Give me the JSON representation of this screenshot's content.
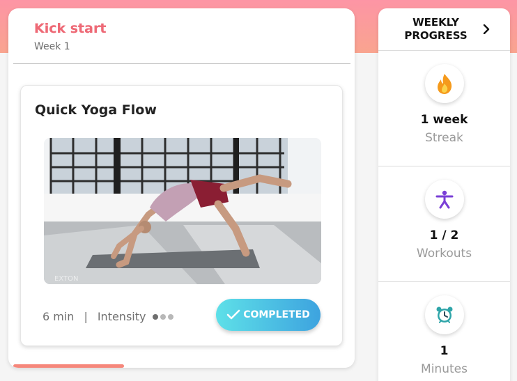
{
  "program": {
    "title": "Kick start",
    "week": "Week 1"
  },
  "workout": {
    "title": "Quick Yoga Flow",
    "duration": "6 min",
    "separator": "|",
    "intensity_label": "Intensity",
    "intensity_level": 1,
    "intensity_max": 3,
    "status_label": "COMPLETED"
  },
  "program_progress": 0.32,
  "weekly_progress": {
    "header": "WEEKLY\nPROGRESS",
    "stats": [
      {
        "value": "1 week",
        "label": "Streak",
        "icon": "flame-icon"
      },
      {
        "value": "1 / 2",
        "label": "Workouts",
        "icon": "person-exercise-icon"
      },
      {
        "value": "1",
        "label": "Minutes",
        "icon": "alarm-clock-icon"
      }
    ]
  },
  "colors": {
    "accent_pink": "#ee6a76",
    "button_start": "#5ee0e8",
    "button_end": "#3da3df",
    "progress": "#f6877b",
    "icon_purple": "#7a3fd6"
  }
}
